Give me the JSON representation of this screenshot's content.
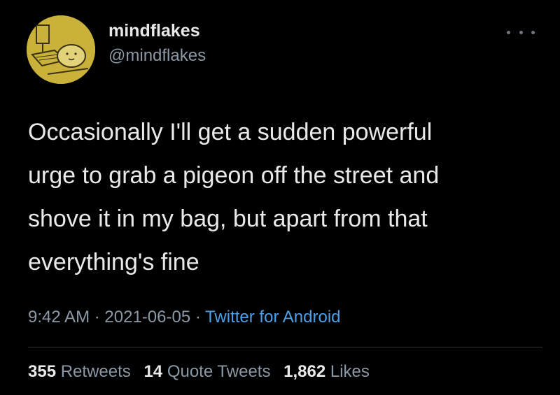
{
  "tweet": {
    "author": {
      "display_name": "mindflakes",
      "handle": "@mindflakes",
      "avatar_icon": "avatar-illustration-icon",
      "avatar_color": "#c9b13a"
    },
    "more_icon": "more-dots-icon",
    "text": "Occasionally I'll get a sudden powerful\nurge to grab a pigeon off the street and\nshove it in my bag, but apart from that\neverything's fine",
    "time": "9:42 AM",
    "date": "2021-06-05",
    "separator": "·",
    "source": "Twitter for Android",
    "source_color": "#4d9fe6",
    "stats": {
      "retweets_count": "355",
      "retweets_label": "Retweets",
      "quote_count": "14",
      "quote_label": "Quote Tweets",
      "likes_count": "1,862",
      "likes_label": "Likes"
    }
  }
}
